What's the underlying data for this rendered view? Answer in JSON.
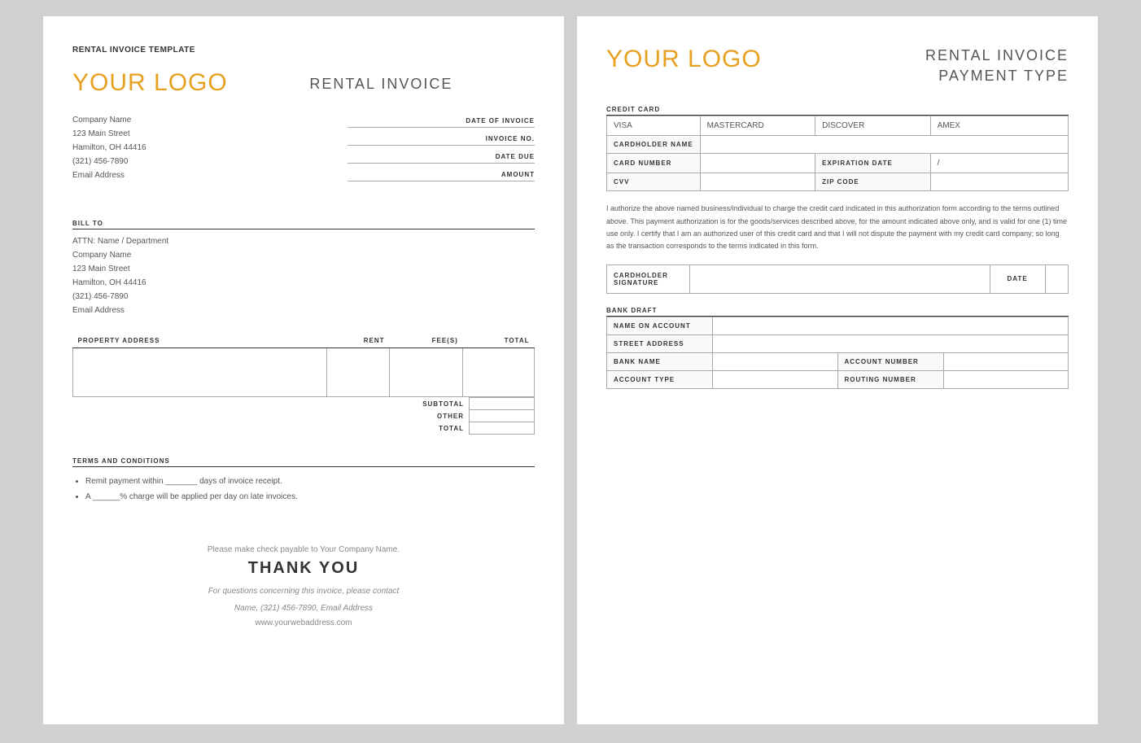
{
  "left": {
    "template_label": "RENTAL INVOICE TEMPLATE",
    "logo": "YOUR LOGO",
    "rental_invoice": "RENTAL INVOICE",
    "company": {
      "name": "Company Name",
      "street": "123 Main Street",
      "city": "Hamilton, OH  44416",
      "phone": "(321) 456-7890",
      "email": "Email Address"
    },
    "invoice_fields": [
      {
        "label": "DATE OF INVOICE"
      },
      {
        "label": "INVOICE NO."
      },
      {
        "label": "DATE DUE"
      },
      {
        "label": "AMOUNT"
      }
    ],
    "bill_to": {
      "label": "BILL TO",
      "attn": "ATTN: Name / Department",
      "company": "Company Name",
      "street": "123 Main Street",
      "city": "Hamilton, OH  44416",
      "phone": "(321) 456-7890",
      "email": "Email Address"
    },
    "table": {
      "headers": [
        "PROPERTY ADDRESS",
        "RENT",
        "FEE(S)",
        "TOTAL"
      ]
    },
    "totals": [
      {
        "label": "SUBTOTAL"
      },
      {
        "label": "OTHER"
      },
      {
        "label": "TOTAL"
      }
    ],
    "terms": {
      "label": "TERMS AND CONDITIONS",
      "items": [
        "Remit payment within _______ days of invoice receipt.",
        "A ______% charge will be applied per day on late invoices."
      ]
    },
    "footer": {
      "check_payable": "Please make check payable to Your Company Name.",
      "thank_you": "THANK YOU",
      "contact_line1": "For questions concerning this invoice, please contact",
      "contact_line2": "Name, (321) 456-7890, Email Address",
      "website": "www.yourwebaddress.com"
    }
  },
  "right": {
    "logo": "YOUR LOGO",
    "title_line1": "RENTAL INVOICE",
    "title_line2": "PAYMENT TYPE",
    "credit_card": {
      "label": "CREDIT CARD",
      "options": [
        "VISA",
        "MASTERCARD",
        "DISCOVER",
        "AMEX"
      ],
      "fields": [
        {
          "label": "CARDHOLDER NAME",
          "colspan": 3
        },
        {
          "label": "CARD NUMBER",
          "extra_label": "EXPIRATION DATE",
          "extra_value": "/"
        },
        {
          "label": "CVV",
          "extra_label": "ZIP CODE"
        }
      ]
    },
    "auth_text": "I authorize the above named business/individual to charge the credit card indicated in this authorization form according to the terms outlined above. This payment authorization is for the goods/services described above, for the amount indicated above only, and is valid for one (1) time use only. I certify that I am an authorized user of this credit card and that I will not dispute the payment with my credit card company; so long as the transaction corresponds to the terms indicated in this form.",
    "signature": {
      "cardholder_label": "CARDHOLDER\nSIGNATURE",
      "date_label": "DATE"
    },
    "bank_draft": {
      "label": "BANK DRAFT",
      "fields": [
        {
          "label": "NAME ON ACCOUNT",
          "span": 3
        },
        {
          "label": "STREET ADDRESS",
          "span": 3
        },
        {
          "label": "BANK NAME",
          "extra_label": "ACCOUNT NUMBER"
        },
        {
          "label": "ACCOUNT TYPE",
          "extra_label": "ROUTING NUMBER"
        }
      ]
    }
  }
}
